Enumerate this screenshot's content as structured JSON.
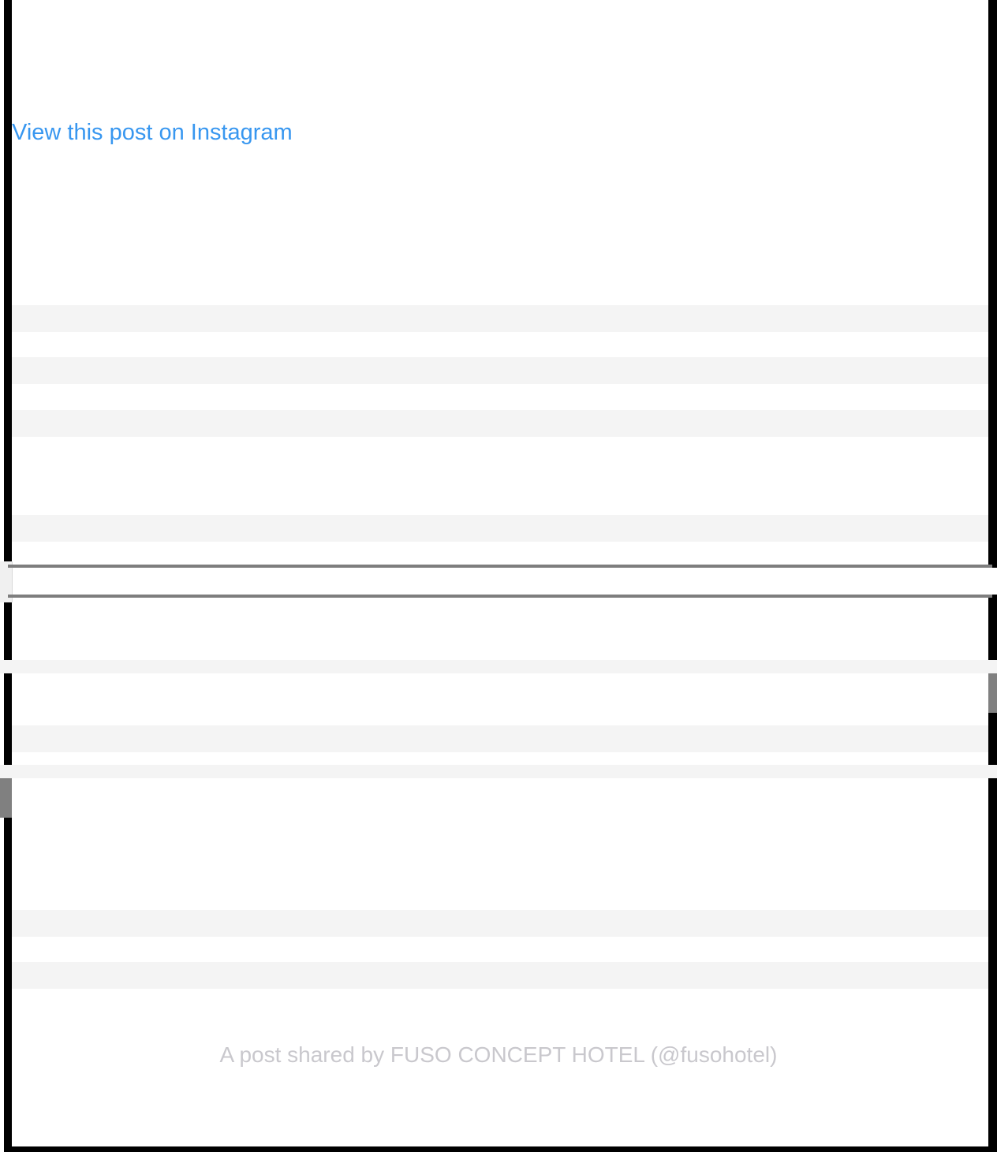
{
  "embed": {
    "view_link_label": "View this post on Instagram",
    "caption": "A post shared by FUSO CONCEPT HOTEL (@fusohotel)"
  },
  "colors": {
    "link": "#3897f0",
    "caption": "#c9c8cd",
    "placeholder": "#f4f4f4",
    "frame": "#000000",
    "divider": "#7e7e7e"
  }
}
